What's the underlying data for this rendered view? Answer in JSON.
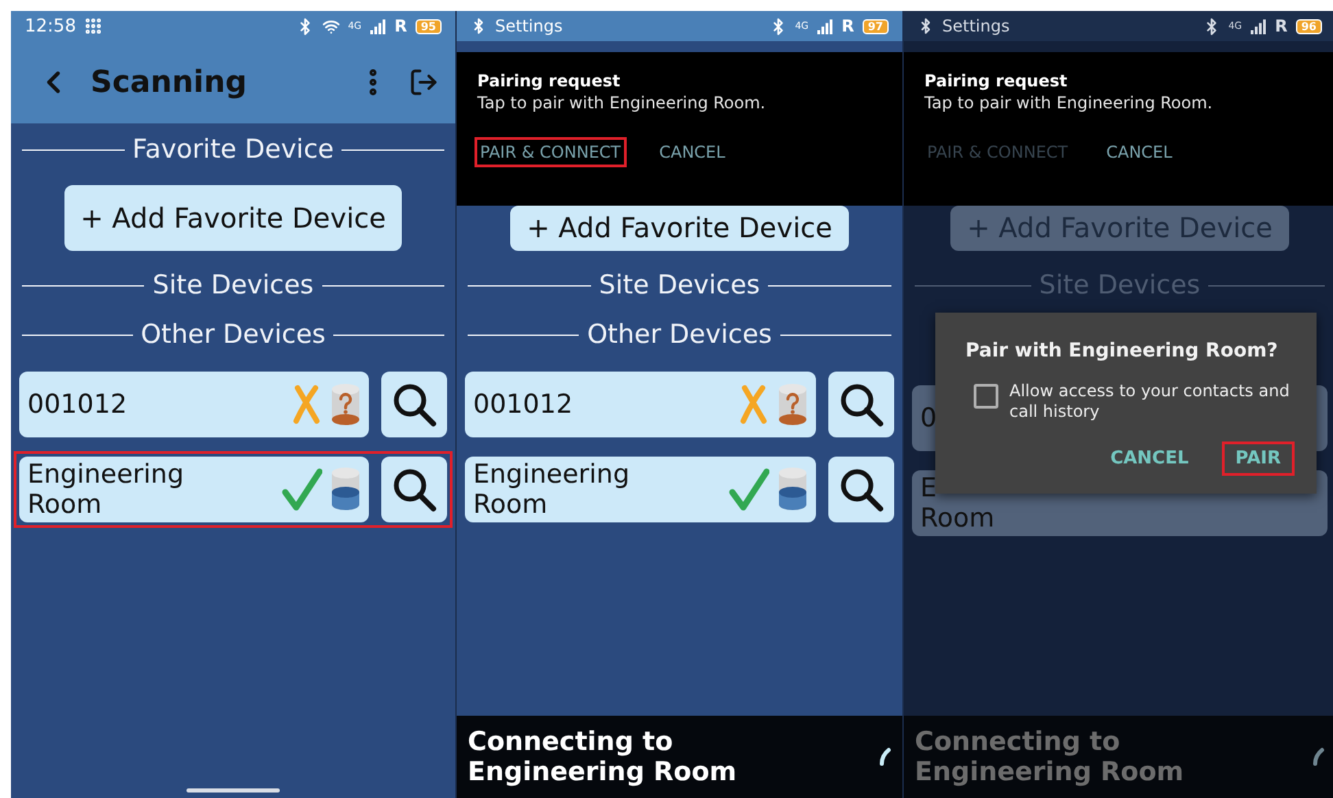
{
  "screens": [
    {
      "kind": "app",
      "dimmed": false,
      "status_bar": {
        "time": "12:58",
        "network": "4G",
        "roaming": "R",
        "battery": "95"
      },
      "app_bar": {
        "title": "Scanning"
      },
      "favorite_header": "Favorite Device",
      "add_button": "+ Add Favorite Device",
      "site_header": "Site Devices",
      "other_header": "Other Devices",
      "devices": [
        {
          "name": "001012",
          "kind": "unknown",
          "highlighted": false
        },
        {
          "name": "Engineering Room",
          "kind": "connected",
          "highlighted": true
        }
      ]
    },
    {
      "kind": "notification",
      "dimmed": false,
      "status_bar": {
        "app_label": "Settings",
        "network": "4G",
        "roaming": "R",
        "battery": "97"
      },
      "notification": {
        "title": "Pairing request",
        "body": "Tap to pair with Engineering Room.",
        "actions": [
          {
            "label": "PAIR & CONNECT",
            "disabled": false,
            "highlighted": true
          },
          {
            "label": "CANCEL",
            "disabled": false,
            "highlighted": false
          }
        ]
      },
      "add_button": "+ Add Favorite Device",
      "site_header": "Site Devices",
      "other_header": "Other Devices",
      "devices": [
        {
          "name": "001012",
          "kind": "unknown",
          "highlighted": false
        },
        {
          "name": "Engineering Room",
          "kind": "connected",
          "highlighted": false
        }
      ],
      "toast": {
        "text": "Connecting to Engineering Room"
      }
    },
    {
      "kind": "dialog",
      "dimmed": true,
      "status_bar": {
        "app_label": "Settings",
        "network": "4G",
        "roaming": "R",
        "battery": "96"
      },
      "notification": {
        "title": "Pairing request",
        "body": "Tap to pair with Engineering Room.",
        "actions": [
          {
            "label": "PAIR & CONNECT",
            "disabled": true,
            "highlighted": false
          },
          {
            "label": "CANCEL",
            "disabled": false,
            "highlighted": false
          }
        ]
      },
      "add_button": "+ Add Favorite Device",
      "site_header": "Site Devices",
      "devices": [
        {
          "name": "0",
          "highlighted": false
        },
        {
          "name": "E\nRoom",
          "highlighted": false
        }
      ],
      "dialog": {
        "title": "Pair with Engineering Room?",
        "checkbox": {
          "label": "Allow access to your contacts and call history",
          "checked": false
        },
        "actions": [
          {
            "label": "CANCEL",
            "highlighted": false
          },
          {
            "label": "PAIR",
            "highlighted": true
          }
        ]
      },
      "toast": {
        "text": "Connecting to Engineering Room"
      }
    }
  ]
}
